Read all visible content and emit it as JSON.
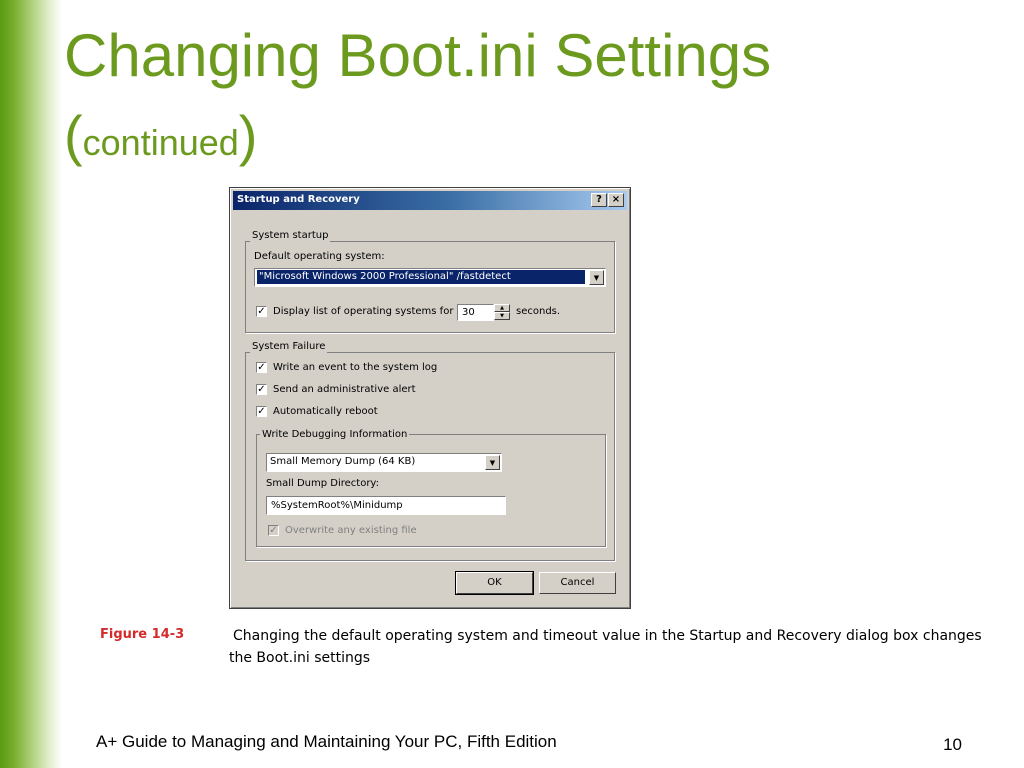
{
  "slide": {
    "title_line1": "Changing Boot.ini Settings",
    "title_paren_open": "(",
    "title_line2": "continued",
    "title_paren_close": ")",
    "caption_label": "Figure 14-3",
    "caption_text": "Changing the default operating system and timeout value in the Startup and Recovery dialog box changes the Boot.ini settings",
    "footer": "A+ Guide to Managing and Maintaining Your PC, Fifth Edition",
    "page_number": "10",
    "accent_color": "#6b9a1e",
    "caption_color": "#d42a2a"
  },
  "dialog": {
    "title": "Startup and Recovery",
    "help_button": "?",
    "close_button": "×",
    "system_startup": {
      "group_label": "System startup",
      "default_os_label": "Default operating system:",
      "default_os_value": "\"Microsoft Windows 2000 Professional\" /fastdetect",
      "display_list_checked": "✓",
      "display_list_label": "Display list of operating systems for",
      "seconds_value": "30",
      "seconds_label": "seconds."
    },
    "system_failure": {
      "group_label": "System Failure",
      "options": [
        {
          "label": "Write an event to the system log",
          "checked": "✓"
        },
        {
          "label": "Send an administrative alert",
          "checked": "✓"
        },
        {
          "label": "Automatically reboot",
          "checked": "✓"
        }
      ],
      "debug": {
        "group_label": "Write Debugging Information",
        "dump_type_value": "Small Memory Dump (64 KB)",
        "dump_dir_label": "Small Dump Directory:",
        "dump_dir_value": "%SystemRoot%\\Minidump",
        "overwrite_checked": "✓",
        "overwrite_label": "Overwrite any existing file"
      }
    },
    "ok_label": "OK",
    "cancel_label": "Cancel"
  }
}
